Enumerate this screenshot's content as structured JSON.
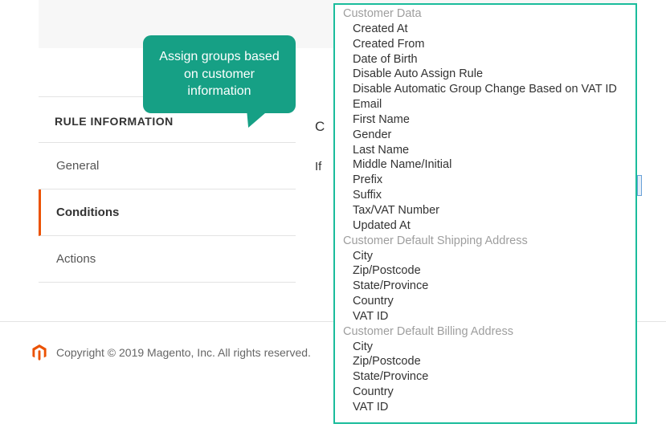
{
  "panel": {
    "title": "RULE INFORMATION",
    "nav": [
      {
        "label": "General",
        "active": false
      },
      {
        "label": "Conditions",
        "active": true
      },
      {
        "label": "Actions",
        "active": false
      }
    ]
  },
  "main": {
    "section_initial": "C",
    "if_label": "If"
  },
  "callout": {
    "text": "Assign groups based on customer information"
  },
  "dropdown": {
    "groups": [
      {
        "label": "Customer Data",
        "options": [
          "Created At",
          "Created From",
          "Date of Birth",
          "Disable Auto Assign Rule",
          "Disable Automatic Group Change Based on VAT ID",
          "Email",
          "First Name",
          "Gender",
          "Last Name",
          "Middle Name/Initial",
          "Prefix",
          "Suffix",
          "Tax/VAT Number",
          "Updated At"
        ]
      },
      {
        "label": "Customer Default Shipping Address",
        "options": [
          "City",
          "Zip/Postcode",
          "State/Province",
          "Country",
          "VAT ID"
        ]
      },
      {
        "label": "Customer Default Billing Address",
        "options": [
          "City",
          "Zip/Postcode",
          "State/Province",
          "Country",
          "VAT ID"
        ]
      }
    ]
  },
  "footer": {
    "copyright": "Copyright © 2019 Magento, Inc. All rights reserved."
  },
  "colors": {
    "accent": "#16a085",
    "active_border": "#eb5202",
    "dropdown_border": "#1abc9c"
  }
}
